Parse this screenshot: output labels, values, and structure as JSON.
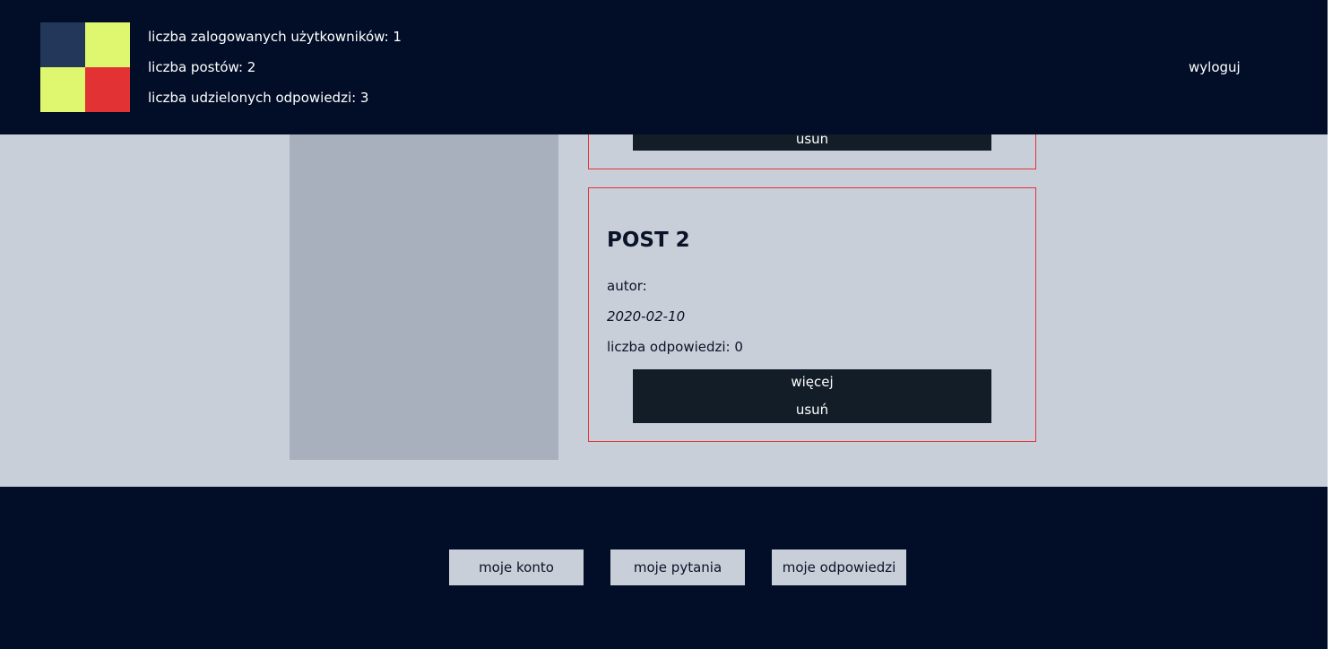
{
  "header": {
    "logo_colors": [
      "#223759",
      "#dff76f",
      "#dff76f",
      "#e33234"
    ],
    "stats": {
      "logged_users": "liczba zalogowanych użytkowników: 1",
      "posts": "liczba postów: 2",
      "answers": "liczba udzielonych odpowiedzi: 3"
    },
    "logout_label": "wyloguj"
  },
  "posts": [
    {
      "delete_label": "usun"
    },
    {
      "title": "POST 2",
      "author": "autor:",
      "date": "2020-02-10",
      "answers_count": "liczba odpowiedzi: 0",
      "more_label": "więcej",
      "delete_label": "usuń"
    }
  ],
  "footer": {
    "buttons": [
      "moje konto",
      "moje pytania",
      "moje odpowiedzi"
    ]
  },
  "colors": {
    "navy": "#020e28",
    "background": "#c8cfd9",
    "sidebar": "#a9b0bd",
    "accent_red": "#e3343a",
    "button_dark": "#131d28"
  }
}
